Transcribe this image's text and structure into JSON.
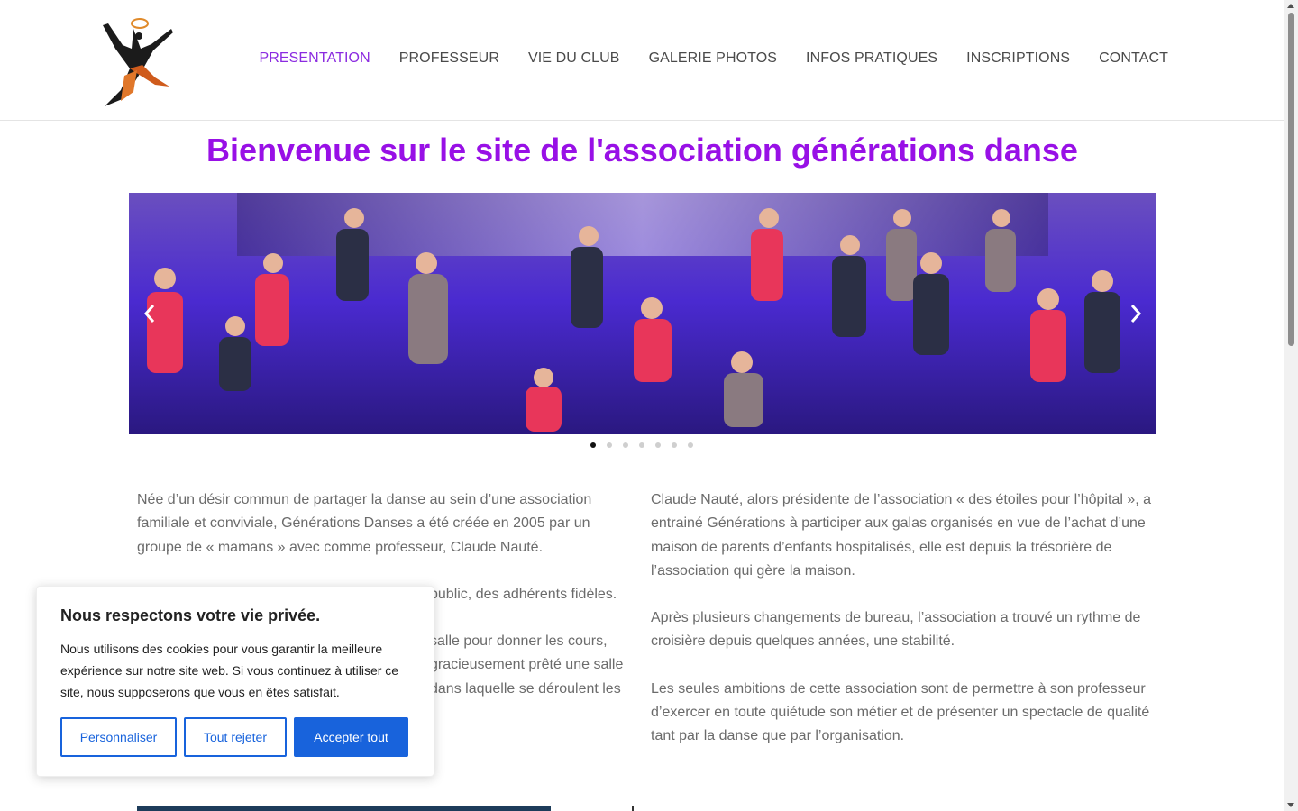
{
  "nav": {
    "items": [
      {
        "label": "PRESENTATION",
        "active": true
      },
      {
        "label": "PROFESSEUR"
      },
      {
        "label": "VIE DU CLUB"
      },
      {
        "label": "GALERIE PHOTOS"
      },
      {
        "label": "INFOS PRATIQUES"
      },
      {
        "label": "INSCRIPTIONS"
      },
      {
        "label": "CONTACT"
      }
    ],
    "active_color": "#8b2be0"
  },
  "page": {
    "title": "Bienvenue sur le site de l'association générations danse",
    "title_color": "#9810e6"
  },
  "slider": {
    "slide_count": 7,
    "active_slide": 1
  },
  "content": {
    "left": [
      "Née d’un désir commun de partager la danse au sein d’une association familiale et conviviale, Générations Danses a été créée en 2005 par un groupe de « mamans » avec comme professeur, Claude Nauté.",
      "public, des adhérents fidèles.",
      "salle pour donner les cours, gracieusement prêté une salle dans laquelle se déroulent les"
    ],
    "right": [
      "Claude Nauté, alors présidente de l’association « des étoiles pour l’hôpital », a entrainé Générations à participer aux galas organisés en vue de l’achat d’une maison de parents d’enfants hospitalisés, elle est depuis la trésorière de l’association qui gère la maison.",
      "Après plusieurs changements de bureau, l’association a trouvé un rythme de croisière depuis quelques années, une stabilité.",
      "Les seules ambitions de cette association sont de permettre à son professeur d’exercer en toute quiétude son métier et de présenter un spectacle de qualité tant par la danse que par l’organisation."
    ]
  },
  "cookie": {
    "title": "Nous respectons votre vie privée.",
    "text": "Nous utilisons des cookies pour vous garantir la meilleure expérience sur notre site web. Si vous continuez à utiliser ce site, nous supposerons que vous en êtes satisfait.",
    "customize_label": "Personnaliser",
    "reject_label": "Tout rejeter",
    "accept_label": "Accepter tout",
    "accent_color": "#1863dc"
  },
  "icons": {
    "logo": "dancer-logo-icon",
    "prev": "chevron-left-icon",
    "next": "chevron-right-icon"
  }
}
